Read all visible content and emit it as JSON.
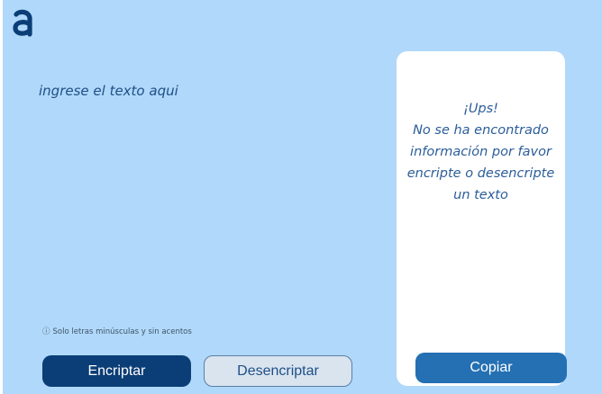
{
  "app": {
    "logo_icon": "alura-a-logo-icon",
    "brand_color": "#0b3d76",
    "background_color": "#b0d8fa"
  },
  "input": {
    "placeholder": "ingrese el texto aqui",
    "value": ""
  },
  "hint": {
    "icon": "info-icon",
    "text": "Solo letras minúsculas y sin acentos"
  },
  "buttons": {
    "encrypt_label": "Encriptar",
    "decrypt_label": "Desencriptar",
    "copy_label": "Copiar"
  },
  "output": {
    "lines": [
      "¡Ups!",
      "No se ha encontrado",
      "información por favor",
      "encripte o desencripte",
      "un texto"
    ]
  }
}
